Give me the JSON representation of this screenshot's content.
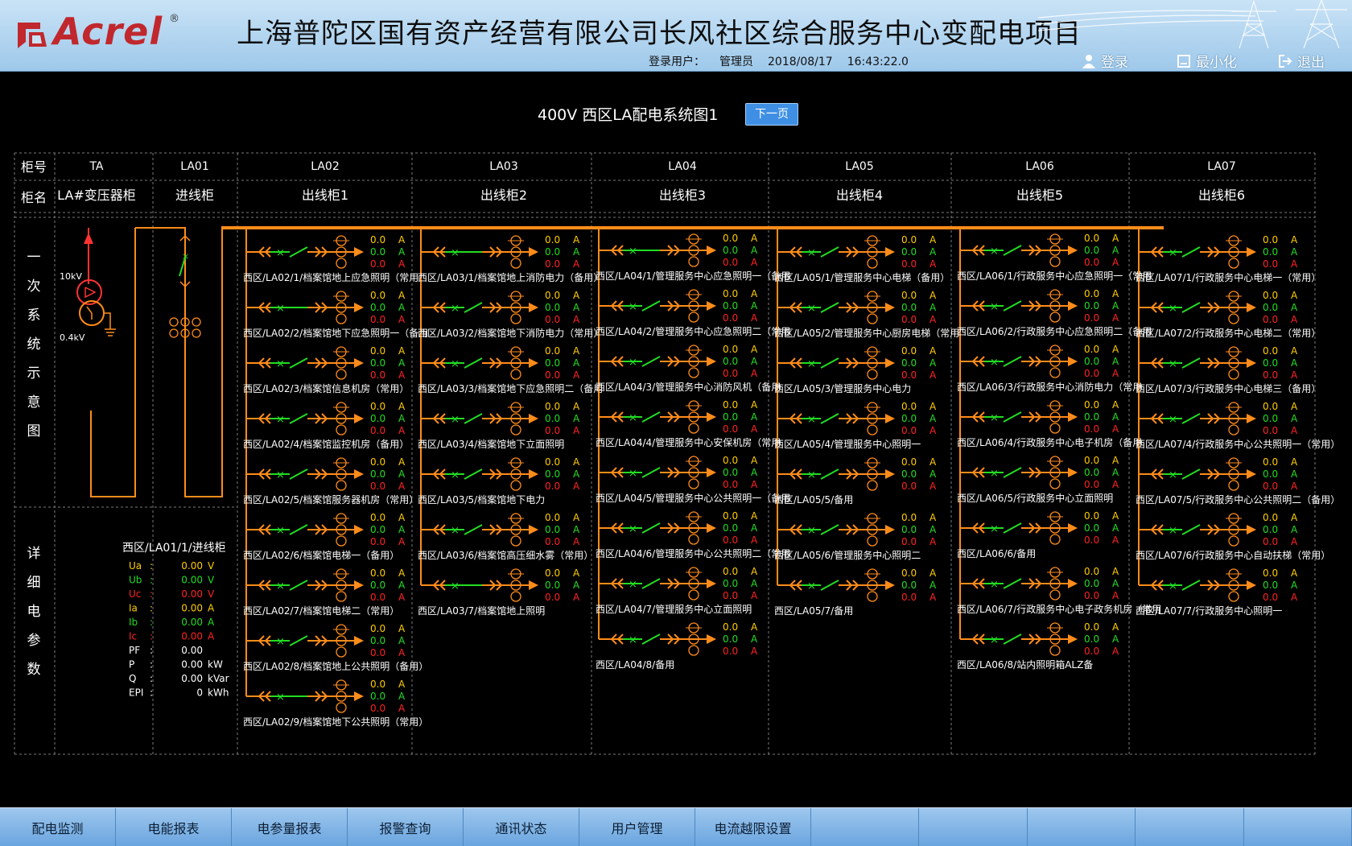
{
  "header": {
    "logo_text": "Acrel",
    "logo_reg": "®",
    "title": "上海普陀区国有资产经营有限公司长风社区综合服务中心变配电项目",
    "login_user_label": "登录用户：",
    "login_user": "管理员",
    "date": "2018/08/17",
    "time": "16:43:22.0",
    "login_btn": "登录",
    "minimize_btn": "最小化",
    "exit_btn": "退出"
  },
  "page": {
    "title": "400V 西区LA配电系统图1",
    "next_btn": "下一页"
  },
  "table": {
    "row_label_no": "柜号",
    "row_label_name": "柜名",
    "cabinets": [
      {
        "no": "TA",
        "name": "LA#变压器柜"
      },
      {
        "no": "LA01",
        "name": "进线柜"
      },
      {
        "no": "LA02",
        "name": "出线柜1"
      },
      {
        "no": "LA03",
        "name": "出线柜2"
      },
      {
        "no": "LA04",
        "name": "出线柜3"
      },
      {
        "no": "LA05",
        "name": "出线柜4"
      },
      {
        "no": "LA06",
        "name": "出线柜5"
      },
      {
        "no": "LA07",
        "name": "出线柜6"
      }
    ],
    "side_primary": [
      "一",
      "次",
      "系",
      "统",
      "示",
      "意",
      "图"
    ],
    "side_detail": [
      "详",
      "细",
      "电",
      "参",
      "数"
    ]
  },
  "transformer": {
    "hv": "10kV",
    "lv": "0.4kV"
  },
  "detail": {
    "title": "西区/LA01/1/进线柜",
    "params": [
      {
        "label": "Ua",
        "colon": ":",
        "value": "0.00",
        "unit": "V",
        "color": "#ffcc00"
      },
      {
        "label": "Ub",
        "colon": ":",
        "value": "0.00",
        "unit": "V",
        "color": "#22dd22"
      },
      {
        "label": "Uc",
        "colon": ":",
        "value": "0.00",
        "unit": "V",
        "color": "#ff2222"
      },
      {
        "label": "Ia",
        "colon": ":",
        "value": "0.00",
        "unit": "A",
        "color": "#ffcc00"
      },
      {
        "label": "Ib",
        "colon": ":",
        "value": "0.00",
        "unit": "A",
        "color": "#22dd22"
      },
      {
        "label": "Ic",
        "colon": ":",
        "value": "0.00",
        "unit": "A",
        "color": "#ff2222"
      },
      {
        "label": "PF",
        "colon": ":",
        "value": "0.00",
        "unit": "",
        "color": "#ffffff"
      },
      {
        "label": "P",
        "colon": ":",
        "value": "0.00",
        "unit": "kW",
        "color": "#ffffff"
      },
      {
        "label": "Q",
        "colon": ":",
        "value": "0.00",
        "unit": "kVar",
        "color": "#ffffff"
      },
      {
        "label": "EPI",
        "colon": ":",
        "value": "0",
        "unit": "kWh",
        "color": "#ffffff"
      }
    ]
  },
  "feeders": {
    "LA02": [
      {
        "label": "西区/LA02/1/档案馆地上应急照明（常用",
        "state": "open"
      },
      {
        "label": "西区/LA02/2/档案馆地下应急照明一（备用",
        "state": "closed"
      },
      {
        "label": "西区/LA02/3/档案馆信息机房（常用）",
        "state": "open"
      },
      {
        "label": "西区/LA02/4/档案馆监控机房（备用）",
        "state": "open"
      },
      {
        "label": "西区/LA02/5/档案馆服务器机房（常用）",
        "state": "open"
      },
      {
        "label": "西区/LA02/6/档案馆电梯一（备用）",
        "state": "open"
      },
      {
        "label": "西区/LA02/7/档案馆电梯二（常用）",
        "state": "open"
      },
      {
        "label": "西区/LA02/8/档案馆地上公共照明（备用）",
        "state": "open"
      },
      {
        "label": "西区/LA02/9/档案馆地下公共照明（常用）",
        "state": "closed"
      }
    ],
    "LA03": [
      {
        "label": "西区/LA03/1/档案馆地上消防电力（备用）",
        "state": "closed"
      },
      {
        "label": "西区/LA03/2/档案馆地下消防电力（常用）",
        "state": "open"
      },
      {
        "label": "西区/LA03/3/档案馆地下应急照明二（备用",
        "state": "open"
      },
      {
        "label": "西区/LA03/4/档案馆地下立面照明",
        "state": "open"
      },
      {
        "label": "西区/LA03/5/档案馆地下电力",
        "state": "open"
      },
      {
        "label": "西区/LA03/6/档案馆高压细水雾（常用）",
        "state": "open"
      },
      {
        "label": "西区/LA03/7/档案馆地上照明",
        "state": "closed"
      }
    ],
    "LA04": [
      {
        "label": "西区/LA04/1/管理服务中心应急照明一（备用",
        "state": "closed"
      },
      {
        "label": "西区/LA04/2/管理服务中心应急照明二（常用",
        "state": "open"
      },
      {
        "label": "西区/LA04/3/管理服务中心消防风机（备用",
        "state": "open"
      },
      {
        "label": "西区/LA04/4/管理服务中心安保机房（常用",
        "state": "open"
      },
      {
        "label": "西区/LA04/5/管理服务中心公共照明一（备用",
        "state": "open"
      },
      {
        "label": "西区/LA04/6/管理服务中心公共照明二（常用",
        "state": "open"
      },
      {
        "label": "西区/LA04/7/管理服务中心立面照明",
        "state": "open"
      },
      {
        "label": "西区/LA04/8/备用",
        "state": "open"
      }
    ],
    "LA05": [
      {
        "label": "西区/LA05/1/管理服务中心电梯（备用）",
        "state": "open"
      },
      {
        "label": "西区/LA05/2/管理服务中心厨房电梯（常用",
        "state": "open"
      },
      {
        "label": "西区/LA05/3/管理服务中心电力",
        "state": "open"
      },
      {
        "label": "西区/LA05/4/管理服务中心照明一",
        "state": "open"
      },
      {
        "label": "西区/LA05/5/备用",
        "state": "open"
      },
      {
        "label": "西区/LA05/6/管理服务中心照明二",
        "state": "open"
      },
      {
        "label": "西区/LA05/7/备用",
        "state": "open"
      }
    ],
    "LA06": [
      {
        "label": "西区/LA06/1/行政服务中心应急照明一（常用",
        "state": "open"
      },
      {
        "label": "西区/LA06/2/行政服务中心应急照明二（备用",
        "state": "open"
      },
      {
        "label": "西区/LA06/3/行政服务中心消防电力（常用",
        "state": "open"
      },
      {
        "label": "西区/LA06/4/行政服务中心电子机房（备用",
        "state": "open"
      },
      {
        "label": "西区/LA06/5/行政服务中心立面照明",
        "state": "open"
      },
      {
        "label": "西区/LA06/6/备用",
        "state": "open"
      },
      {
        "label": "西区/LA06/7/行政服务中心电子政务机房（常用",
        "state": "open"
      },
      {
        "label": "西区/LA06/8/站内照明箱ALZ备",
        "state": "open"
      }
    ],
    "LA07": [
      {
        "label": "西区/LA07/1/行政服务中心电梯一（常用）",
        "state": "open"
      },
      {
        "label": "西区/LA07/2/行政服务中心电梯二（常用）",
        "state": "open"
      },
      {
        "label": "西区/LA07/3/行政服务中心电梯三（备用）",
        "state": "open"
      },
      {
        "label": "西区/LA07/4/行政服务中心公共照明一（常用）",
        "state": "open"
      },
      {
        "label": "西区/LA07/5/行政服务中心公共照明二（备用）",
        "state": "open"
      },
      {
        "label": "西区/LA07/6/行政服务中心自动扶梯（常用）",
        "state": "open"
      },
      {
        "label": "西区/LA07/7/行政服务中心照明一",
        "state": "open"
      }
    ]
  },
  "readings": {
    "value": "0.0",
    "unit": "A"
  },
  "colors": {
    "bus": "#ff8c1a",
    "phase_a": "#ffcc00",
    "phase_b": "#22dd22",
    "phase_c": "#ff2222",
    "grid": "#7a7a7a"
  },
  "bottom_nav": [
    "配电监测",
    "电能报表",
    "电参量报表",
    "报警查询",
    "通讯状态",
    "用户管理",
    "电流越限设置",
    "",
    "",
    "",
    "",
    ""
  ]
}
